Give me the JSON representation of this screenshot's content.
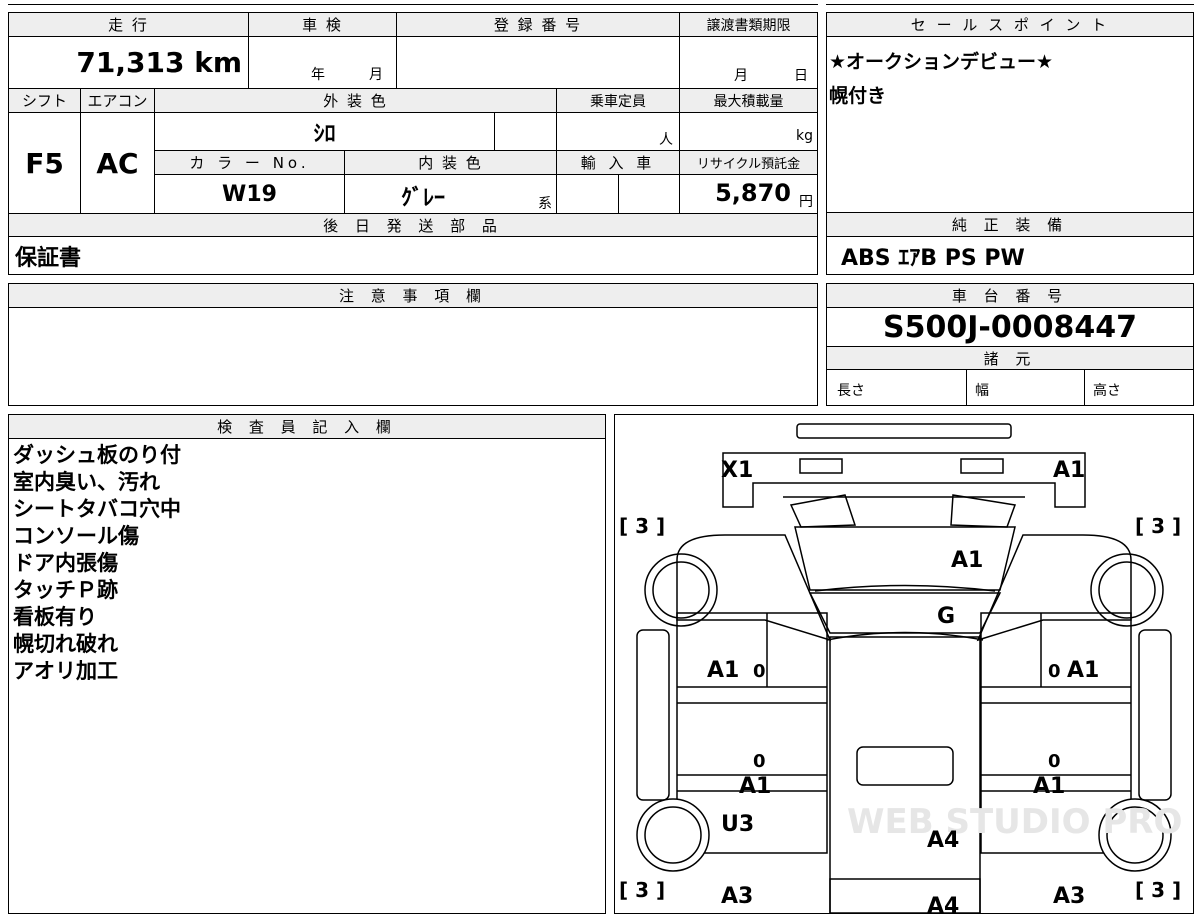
{
  "vehicle": {
    "mileage_label": "走 行",
    "mileage": "71,313 km",
    "inspection_label": "車 検",
    "inspection_year": "年",
    "inspection_month": "月",
    "reg_no_label": "登 録 番 号",
    "transfer_deadline_label": "譲渡書類期限",
    "transfer_month": "月",
    "transfer_day": "日",
    "shift_label": "シフト",
    "shift": "F5",
    "ac_label": "エアコン",
    "ac": "AC",
    "ext_color_label": "外 装 色",
    "ext_color": "ｼﾛ",
    "capacity_label": "乗車定員",
    "capacity_unit": "人",
    "max_load_label": "最大積載量",
    "max_load_unit": "kg",
    "color_no_label": "カ ラ ー No.",
    "color_no": "W19",
    "int_color_label": "内 装 色",
    "int_color": "ｸﾞﾚｰ",
    "int_color_suffix": "系",
    "import_label": "輸 入 車",
    "recycle_label": "リサイクル預託金",
    "recycle_fee": "5,870",
    "recycle_unit": "円",
    "later_parts_label": "後 日 発 送 部 品",
    "later_parts": "保証書"
  },
  "sales": {
    "label": "セ ー ル ス ポ イ ン ト",
    "lines": [
      "★オークションデビュー★",
      "幌付き"
    ]
  },
  "equipment": {
    "label": "純 正 装 備",
    "value": "ABS ｴｱB PS PW"
  },
  "caution": {
    "label": "注 意 事 項 欄"
  },
  "chassis": {
    "label": "車 台 番 号",
    "value": "S500J-0008447"
  },
  "specs": {
    "label": "諸 元",
    "length": "長さ",
    "width": "幅",
    "height": "高さ"
  },
  "inspector": {
    "label": "検 査 員 記 入 欄",
    "notes": [
      "ダッシュ板のり付",
      "室内臭い、汚れ",
      "シートタバコ穴中",
      "コンソール傷",
      "ドア内張傷",
      "タッチＰ跡",
      "看板有り",
      "幌切れ破れ",
      "アオリ加工"
    ]
  },
  "diagram": {
    "marks": {
      "front_left": "X1",
      "front_right": "A1",
      "tire_fl": "[ 3 ]",
      "tire_fr": "[ 3 ]",
      "hood": "A1",
      "windshield": "G",
      "door_l": "A1",
      "door_r": "A1",
      "door_l_zero": "0",
      "door_r_zero": "0",
      "lower_l_zero": "0",
      "lower_r_zero": "0",
      "sill_l": "A1",
      "sill_r": "A1",
      "rear_fender_l": "U3",
      "bed": "A4",
      "tire_rl": "[ 3 ]",
      "tire_rr": "[ 3 ]",
      "rear_l": "A3",
      "rear_r": "A3",
      "rear_c": "A4"
    },
    "watermark": "WEB STUDIO PRO"
  }
}
